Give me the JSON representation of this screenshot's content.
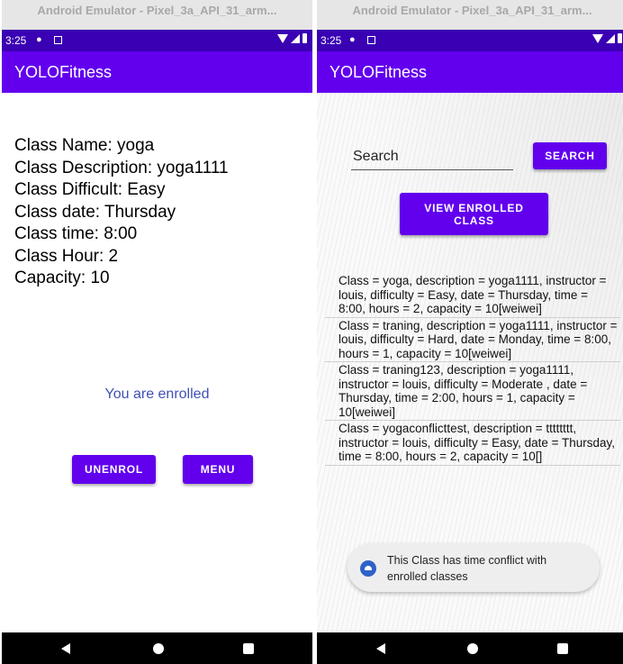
{
  "left_window": {
    "title": "Android Emulator - Pixel_3a_API_31_arm...",
    "status_time": "3:25",
    "app_title": "YOLOFitness",
    "details": [
      "Class Name: yoga",
      "Class Description: yoga1111",
      "Class Difficult: Easy",
      "Class date: Thursday",
      "Class time: 8:00",
      "Class Hour: 2",
      "Capacity: 10"
    ],
    "enrolled_message": "You are enrolled",
    "unenrol_label": "UNENROL",
    "menu_label": "MENU"
  },
  "right_window": {
    "title": "Android Emulator - Pixel_3a_API_31_arm...",
    "status_time": "3:25",
    "app_title": "YOLOFitness",
    "search_value": "Search",
    "search_button": "SEARCH",
    "view_enrolled_button": "VIEW ENROLLED CLASS",
    "classes": [
      "Class = yoga, description = yoga1111, instructor = louis, difficulty = Easy, date = Thursday, time = 8:00, hours = 2, capacity = 10[weiwei]",
      "Class = traning, description = yoga1111, instructor = louis, difficulty = Hard, date = Monday, time = 8:00, hours = 1, capacity = 10[weiwei]",
      "Class = traning123, description = yoga1111, instructor = louis, difficulty = Moderate , date = Thursday, time = 2:00, hours = 1, capacity = 10[weiwei]",
      "Class = yogaconflicttest, description = tttttttt, instructor = louis, difficulty = Easy, date = Thursday, time = 8:00, hours = 2, capacity = 10[]"
    ],
    "toast_message": "This Class has time conflict with enrolled classes"
  },
  "icons": {
    "status": [
      "message-icon",
      "notification-icon",
      "wifi-icon",
      "signal-icon",
      "battery-icon"
    ],
    "nav": [
      "back-icon",
      "home-icon",
      "recents-icon"
    ],
    "toast": "android-icon"
  },
  "colors": {
    "primary": "#6200ee",
    "status_bar": "#3a00b3",
    "enrolled_text": "#3f51b5",
    "nav_bar": "#000000"
  }
}
